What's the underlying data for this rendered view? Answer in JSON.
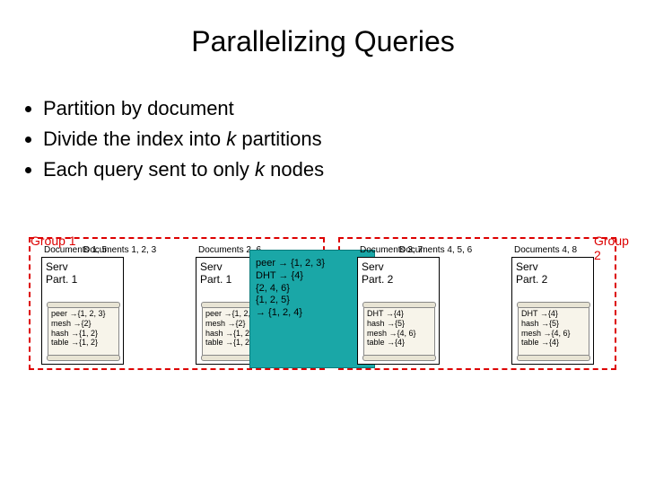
{
  "title": "Parallelizing Queries",
  "bullets": [
    "Partition by document",
    "Divide the index into k partitions",
    "Each query sent to only k nodes"
  ],
  "groups": {
    "g1": "Group 1",
    "g2": "Group 2"
  },
  "panels": [
    {
      "doc": "Documents 1, 5",
      "range": "Documents 1, 2, 3",
      "serv": "Serv",
      "part": "Part. 1",
      "rows": [
        "peer →{1, 2, 3}",
        "mesh →{2}",
        "hash →{1, 2}",
        "table →{1, 2}"
      ]
    },
    {
      "doc": "Documents 2, 6",
      "range": "",
      "serv": "Serv",
      "part": "Part. 1",
      "rows": [
        "peer →{1, 2, 3}",
        "mesh →{2}",
        "hash →{1, 2}",
        "table →{1, 2}"
      ]
    },
    {
      "doc": "Documents 3, 7",
      "range": "Documents 4, 5, 6",
      "serv": "Serv",
      "part": "Part. 2",
      "rows": [
        "DHT →{4}",
        "hash →{5}",
        "mesh →{4, 6}",
        "table →{4}"
      ]
    },
    {
      "doc": "Documents 4, 8",
      "range": "",
      "serv": "Serv",
      "part": "Part. 2",
      "rows": [
        "DHT →{4}",
        "hash →{5}",
        "mesh →{4, 6}",
        "table →{4}"
      ]
    }
  ],
  "center": {
    "rows": [
      "peer → {1, 2, 3}",
      "DHT → {4}",
      "{2, 4, 6}",
      "{1, 2, 5}",
      "→ {1, 2, 4}"
    ]
  }
}
